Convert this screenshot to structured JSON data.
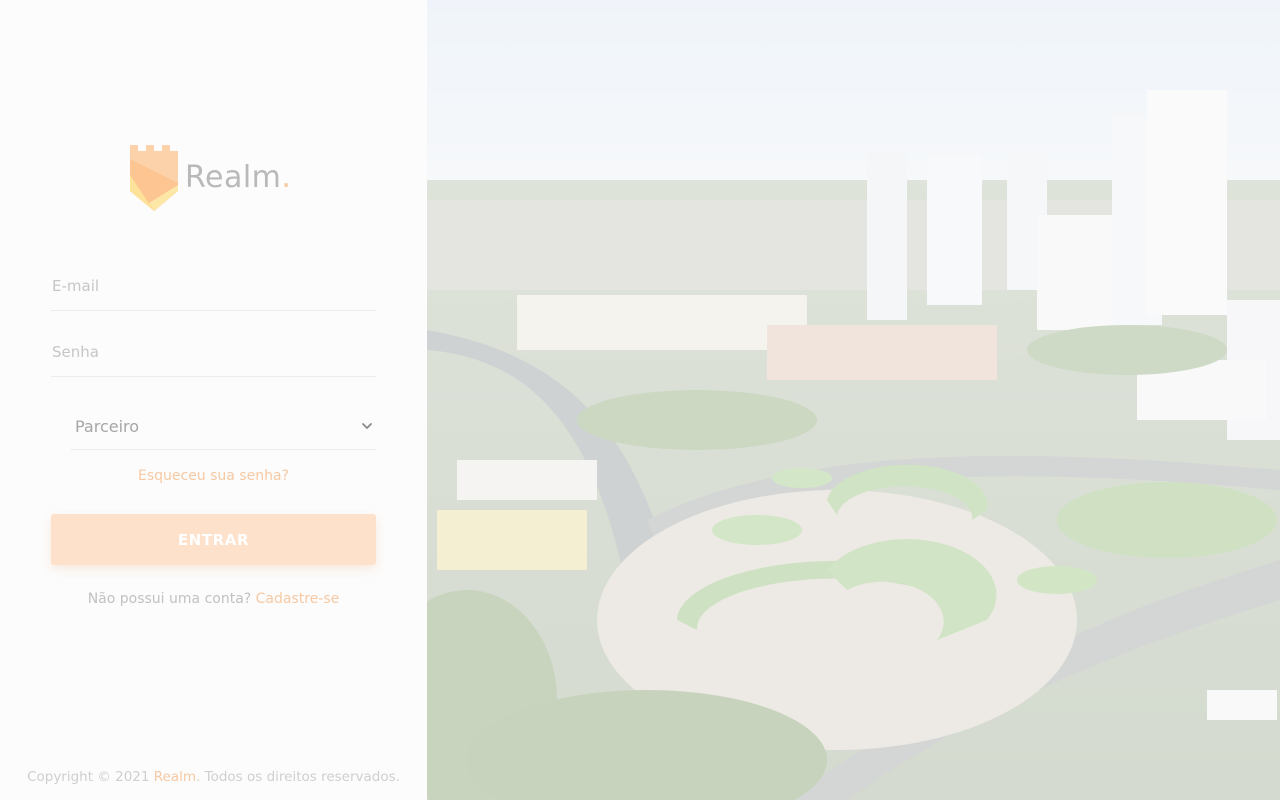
{
  "brand": {
    "name": "Realm",
    "dot": "."
  },
  "login": {
    "email_placeholder": "E-mail",
    "password_placeholder": "Senha",
    "role_selected": "Parceiro",
    "forgot_label": "Esqueceu sua senha?",
    "submit_label": "ENTRAR",
    "signup_prefix": "Não possui uma conta?",
    "signup_link": "Cadastre-se"
  },
  "footer": {
    "prefix": "Copyright © 2021",
    "brand": "Realm",
    "suffix": ". Todos os direitos reservados."
  },
  "colors": {
    "accent": "#f6c9a3",
    "button_bg": "#fde1cb",
    "logo_orange": "#f8b27a",
    "logo_yellow": "#fde08f"
  },
  "icons": {
    "select_arrow": "chevron-down-icon",
    "logo": "castle-logo-icon"
  }
}
